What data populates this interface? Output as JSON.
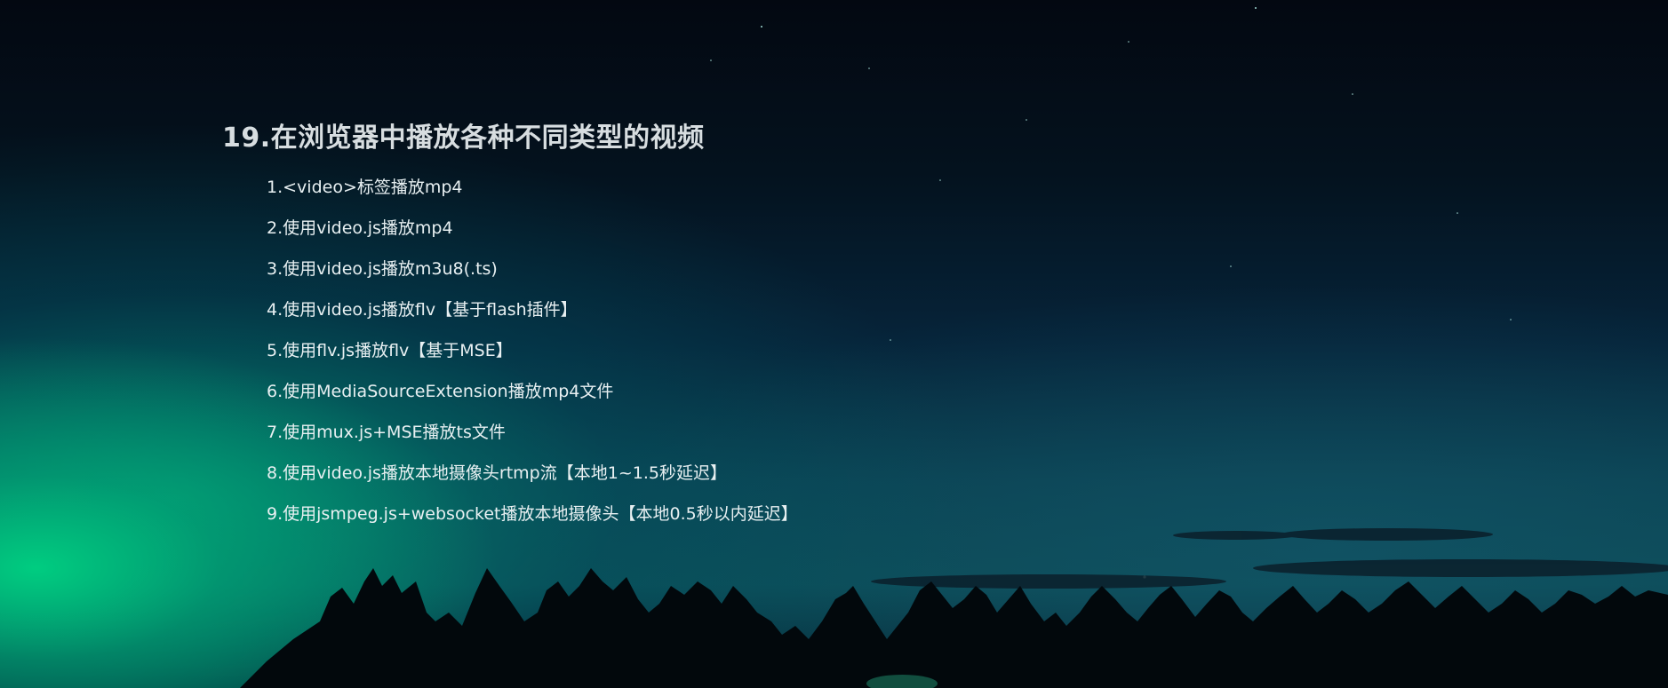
{
  "page": {
    "title": "19.在浏览器中播放各种不同类型的视频"
  },
  "links": [
    "1.<video>标签播放mp4",
    "2.使用video.js播放mp4",
    "3.使用video.js播放m3u8(.ts)",
    "4.使用video.js播放flv【基于flash插件】",
    "5.使用flv.js播放flv【基于MSE】",
    "6.使用MediaSourceExtension播放mp4文件",
    "7.使用mux.js+MSE播放ts文件",
    "8.使用video.js播放本地摄像头rtmp流【本地1~1.5秒延迟】",
    "9.使用jsmpeg.js+websocket播放本地摄像头【本地0.5秒以内延迟】"
  ],
  "colors": {
    "title": "#d7dde0",
    "link_text": "#e8f0f2",
    "aurora_green": "#00c878",
    "sky_dark": "#030811"
  }
}
